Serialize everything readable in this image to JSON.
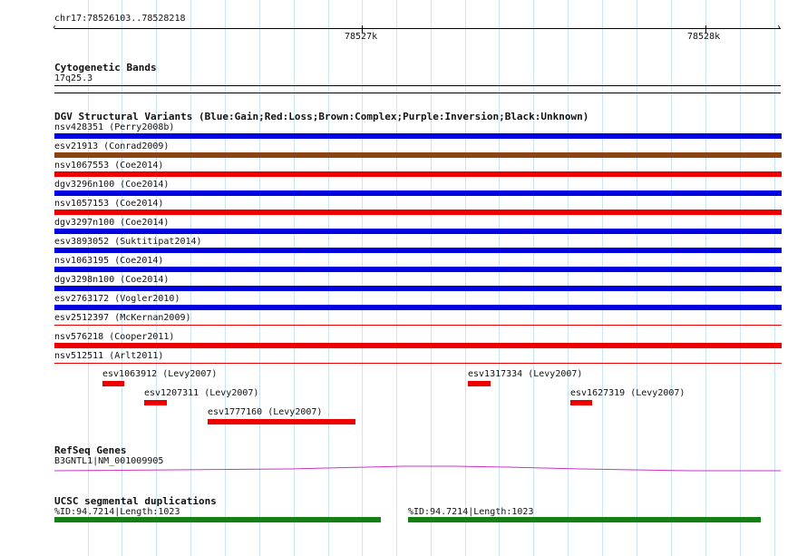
{
  "ruler": {
    "region_label": "chr17:78526103..78528218",
    "tick_labels": [
      "78527k",
      "78528k"
    ]
  },
  "cytoband": {
    "title": "Cytogenetic Bands",
    "band_label": "17q25.3"
  },
  "dgv": {
    "title": "DGV Structural Variants (Blue:Gain;Red:Loss;Brown:Complex;Purple:Inversion;Black:Unknown)",
    "colors": {
      "gain": "#0000e0",
      "loss": "#ee0000",
      "complex": "#8b4513"
    },
    "full_variants": [
      {
        "label": "nsv428351 (Perry2008b)",
        "type": "gain",
        "style": "thick"
      },
      {
        "label": "esv21913 (Conrad2009)",
        "type": "complex",
        "style": "thick"
      },
      {
        "label": "nsv1067553 (Coe2014)",
        "type": "loss",
        "style": "thick"
      },
      {
        "label": "dgv3296n100 (Coe2014)",
        "type": "gain",
        "style": "thick"
      },
      {
        "label": "nsv1057153 (Coe2014)",
        "type": "loss",
        "style": "thick"
      },
      {
        "label": "dgv3297n100 (Coe2014)",
        "type": "gain",
        "style": "thick"
      },
      {
        "label": "esv3893052 (Suktitipat2014)",
        "type": "gain",
        "style": "thick"
      },
      {
        "label": "nsv1063195 (Coe2014)",
        "type": "gain",
        "style": "thick"
      },
      {
        "label": "dgv3298n100 (Coe2014)",
        "type": "gain",
        "style": "thick"
      },
      {
        "label": "esv2763172 (Vogler2010)",
        "type": "gain",
        "style": "thick"
      },
      {
        "label": "esv2512397 (McKernan2009)",
        "type": "loss",
        "style": "thin"
      },
      {
        "label": "nsv576218 (Cooper2011)",
        "type": "loss",
        "style": "thick"
      },
      {
        "label": "nsv512511 (Arlt2011)",
        "type": "loss",
        "style": "thin"
      }
    ],
    "partial_variants": [
      {
        "label": "esv1063912 (Levy2007)",
        "type": "loss"
      },
      {
        "label": "esv1207311 (Levy2007)",
        "type": "loss"
      },
      {
        "label": "esv1777160 (Levy2007)",
        "type": "loss"
      },
      {
        "label": "esv1317334 (Levy2007)",
        "type": "loss"
      },
      {
        "label": "esv1627319 (Levy2007)",
        "type": "loss"
      }
    ]
  },
  "refseq": {
    "title": "RefSeq Genes",
    "gene_label": "B3GNTL1|NM_001009905",
    "color": "#cc33cc"
  },
  "segdup": {
    "title": "UCSC segmental duplications",
    "color": "#128012",
    "items": [
      {
        "label": "%ID:94.7214|Length:1023"
      },
      {
        "label": "%ID:94.7214|Length:1023"
      }
    ]
  }
}
